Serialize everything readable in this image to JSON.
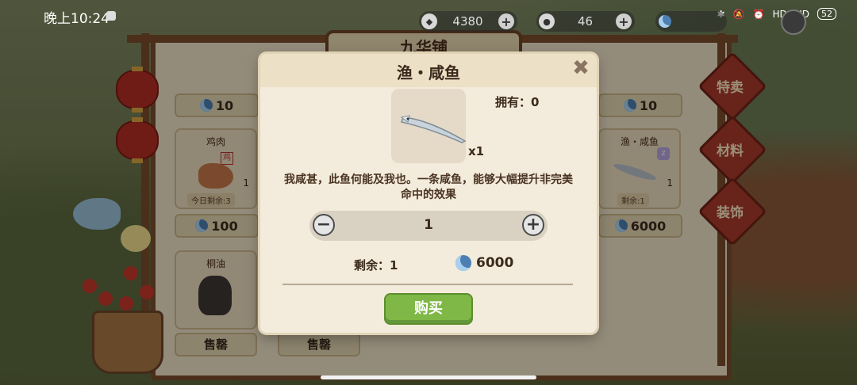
{
  "status_bar": {
    "time": "晚上10:24",
    "right_icons": [
      "bluetooth-icon",
      "mute-icon",
      "alarm-icon",
      "HD",
      "HD"
    ],
    "battery": "52"
  },
  "currency": [
    {
      "icon": "coin-icon",
      "value": "4380"
    },
    {
      "icon": "gem-icon",
      "value": "46"
    },
    {
      "icon": "moon-coin-icon",
      "value": ""
    }
  ],
  "shop": {
    "sign": "九华铺",
    "cards": [
      {
        "name": "鸡肉",
        "tag": "鸡",
        "count": "1",
        "remain": "今日剩余:3",
        "price": "100"
      },
      {
        "name": "桐油",
        "action": "售罄"
      },
      {
        "action": "售罄"
      },
      {
        "name": "渔・咸鱼",
        "count": "1",
        "remain": "剩余:1",
        "price": "6000"
      }
    ],
    "top_prices": [
      "10",
      "10"
    ],
    "side_tabs": [
      "特卖",
      "材料",
      "装饰"
    ]
  },
  "modal": {
    "title": "渔・咸鱼",
    "owned": "拥有：0",
    "quantity_label": "x1",
    "description": "我咸甚，此鱼何能及我也。一条咸鱼，能够大幅提升非完美命中的效果",
    "stepper_value": "1",
    "remaining": "剩余：1",
    "price": "6000",
    "buy_label": "购买"
  },
  "colors": {
    "buy_green": "#7fb846",
    "modal_bg": "#f3ebdb",
    "stall_red": "#a83a2a"
  }
}
